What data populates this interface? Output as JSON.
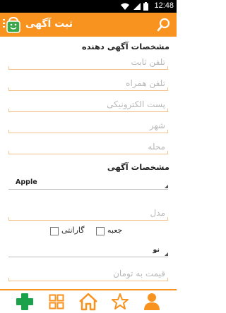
{
  "status": {
    "time": "12:48",
    "icons": [
      "wifi-icon",
      "signal-icon",
      "battery-icon"
    ]
  },
  "appbar": {
    "title": "ثبت آگهی",
    "logo_icon": "shopping-bag-icon",
    "search_icon": "search-icon"
  },
  "advertiser_section": {
    "title": "مشخصات آگهی دهنده",
    "fields": [
      {
        "placeholder": "تلفن ثابت",
        "value": ""
      },
      {
        "placeholder": "تلفن همراه",
        "value": ""
      },
      {
        "placeholder": "پست الکترونیکی",
        "value": ""
      },
      {
        "placeholder": "شهر",
        "value": ""
      },
      {
        "placeholder": "محله",
        "value": ""
      }
    ]
  },
  "ad_section": {
    "title": "مشخصات آگهی",
    "brand_select": "Apple",
    "model_placeholder": "مدل",
    "checkboxes": [
      {
        "label": "جعبه",
        "checked": false
      },
      {
        "label": "گارانتی",
        "checked": false
      }
    ],
    "condition_select": "نو",
    "price_placeholder": "قیمت به تومان"
  },
  "bottom_nav": {
    "items": [
      "add-icon",
      "grid-icon",
      "home-icon",
      "star-icon",
      "profile-icon"
    ],
    "colors": {
      "add": "#1aa14a",
      "orange": "#f7931e"
    }
  }
}
